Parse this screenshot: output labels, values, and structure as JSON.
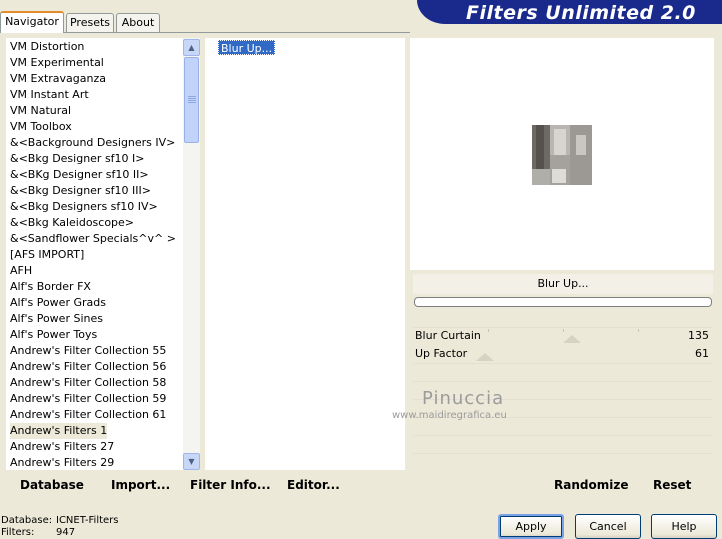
{
  "header": {
    "banner_title": "Filters Unlimited 2.0"
  },
  "tabs": [
    {
      "label": "Navigator",
      "active": true
    },
    {
      "label": "Presets",
      "active": false
    },
    {
      "label": "About",
      "active": false
    }
  ],
  "categories": {
    "items": [
      " VM Distortion",
      " VM Experimental",
      " VM Extravaganza",
      " VM Instant Art",
      " VM Natural",
      " VM Toolbox",
      "&<Background Designers IV>",
      "&<Bkg Designer sf10 I>",
      "&<BKg Designer sf10 II>",
      "&<Bkg Designer sf10 III>",
      "&<Bkg Designers sf10 IV>",
      "&<Bkg Kaleidoscope>",
      "&<Sandflower Specials^v^ >",
      "[AFS IMPORT]",
      "AFH",
      "Alf's Border FX",
      "Alf's Power Grads",
      "Alf's Power Sines",
      "Alf's Power Toys",
      "Andrew's Filter Collection 55",
      "Andrew's Filter Collection 56",
      "Andrew's Filter Collection 58",
      "Andrew's Filter Collection 59",
      "Andrew's Filter Collection 61",
      "Andrew's Filters 1",
      "Andrew's Filters 27",
      "Andrew's Filters 29"
    ],
    "selected_index": 24
  },
  "filters": {
    "selected": "Blur Up..."
  },
  "preview": {
    "filter_title": "Blur Up..."
  },
  "parameters": [
    {
      "label": "Blur Curtain",
      "value": "135",
      "fraction": 0.53
    },
    {
      "label": "Up Factor",
      "value": "61",
      "fraction": 0.24
    }
  ],
  "toolbar": {
    "database": "Database",
    "import": "Import...",
    "filter_info": "Filter Info...",
    "editor": "Editor...",
    "randomize": "Randomize",
    "reset": "Reset"
  },
  "status": {
    "database_label": "Database:",
    "database_value": "ICNET-Filters",
    "filters_label": "Filters:",
    "filters_value": "947"
  },
  "buttons": {
    "apply": "Apply",
    "cancel": "Cancel",
    "help": "Help"
  },
  "watermark": {
    "name": "Pinuccia",
    "url": "www.maidiregrafica.eu"
  }
}
